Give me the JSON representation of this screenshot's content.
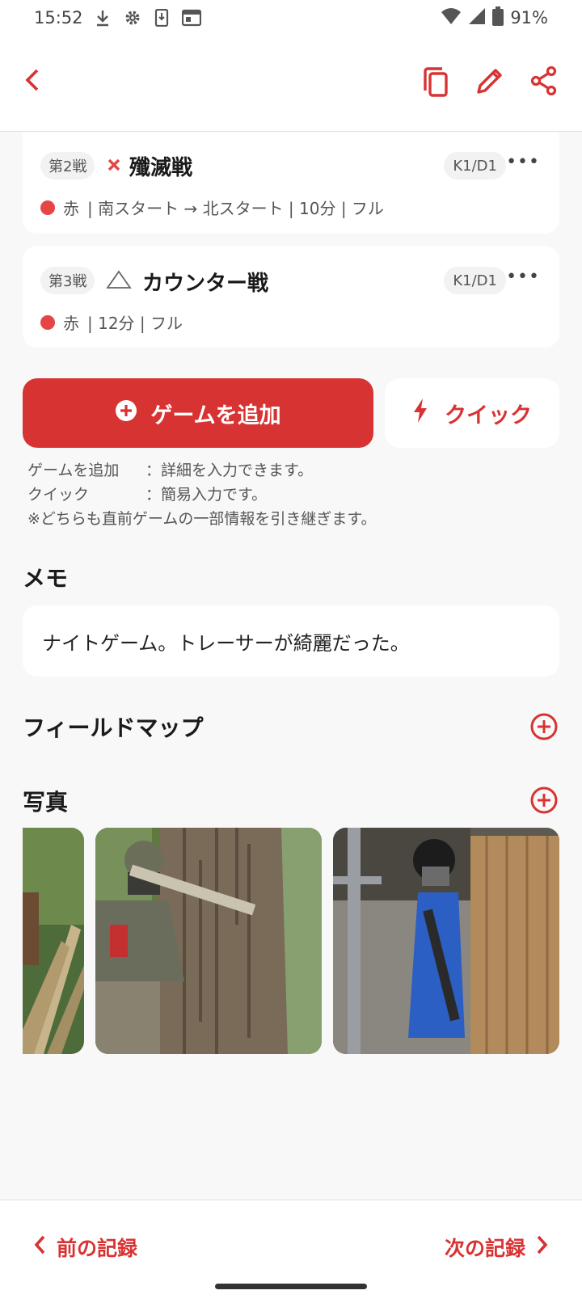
{
  "status": {
    "time": "15:52",
    "battery": "91%"
  },
  "appbar": {
    "icons": [
      "chevron-left-icon",
      "copy-icon",
      "pencil-icon",
      "share-icon"
    ]
  },
  "games": [
    {
      "number": "第2戦",
      "result_icon": "cross-icon",
      "name": "殲滅戦",
      "tag": "K1/D1",
      "team": "赤",
      "details": "| 南スタート → 北スタート | 10分 | フル"
    },
    {
      "number": "第3戦",
      "result_icon": "triangle-icon",
      "name": "カウンター戦",
      "tag": "K1/D1",
      "team": "赤",
      "details": "| 12分 | フル"
    }
  ],
  "actions": {
    "add_game": "ゲームを追加",
    "quick": "クイック"
  },
  "help": {
    "line1_key": "ゲームを追加",
    "line1_val": "：詳細を入力できます。",
    "line2_key": "クイック",
    "line2_val": "：簡易入力です。",
    "note": "※どちらも直前ゲームの一部情報を引き継ぎます。"
  },
  "memo": {
    "title": "メモ",
    "text": "ナイトゲーム。トレーサーが綺麗だった。"
  },
  "field_map": {
    "title": "フィールドマップ"
  },
  "photos": {
    "title": "写真",
    "count_visible": 3
  },
  "nav": {
    "prev": "前の記録",
    "next": "次の記録"
  },
  "colors": {
    "accent": "#d83333",
    "team_red": "#e64545"
  }
}
